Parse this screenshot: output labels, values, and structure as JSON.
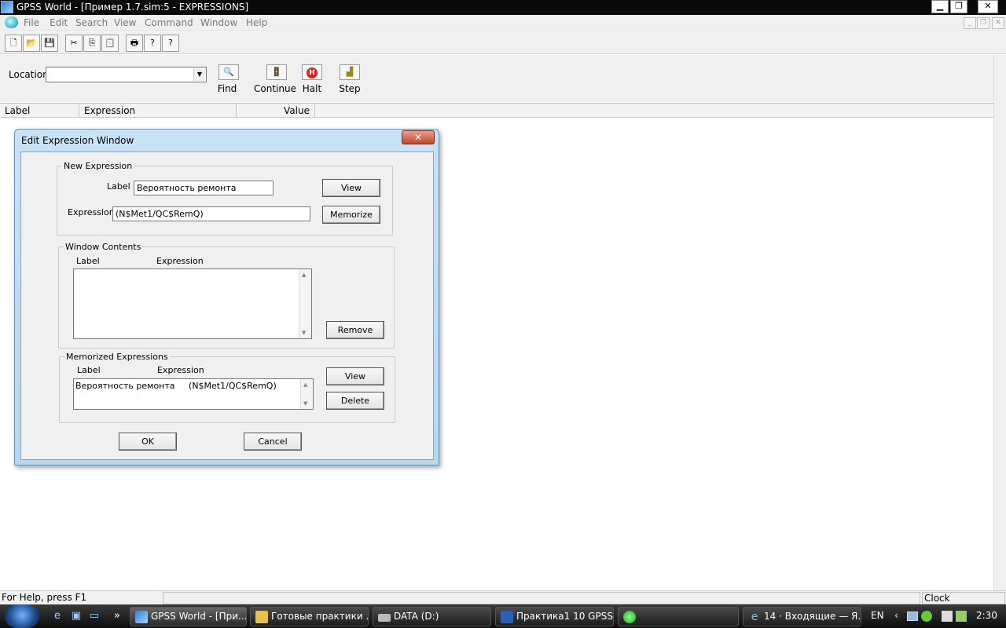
{
  "window": {
    "title": "GPSS World - [Пример 1.7.sim:5  -  EXPRESSIONS]",
    "minimize": "▁",
    "restore": "❐",
    "close": "✕"
  },
  "menu": {
    "items": [
      "File",
      "Edit",
      "Search",
      "View",
      "Command",
      "Window",
      "Help"
    ],
    "mdi_minimize": "_",
    "mdi_restore": "❐",
    "mdi_close": "✕"
  },
  "toolbar": {
    "icons": [
      "new-icon",
      "open-icon",
      "save-icon",
      "cut-icon",
      "copy-icon",
      "paste-icon",
      "print-icon",
      "help-icon",
      "context-help-icon"
    ],
    "glyphs": [
      "🗋",
      "📂",
      "💾",
      "✂",
      "⎘",
      "📋",
      "🖶",
      "?",
      "?"
    ]
  },
  "location": {
    "label": "Location",
    "value": "",
    "dropdown": "▼"
  },
  "commands": {
    "find": {
      "label": "Find",
      "glyph": "🔍"
    },
    "continue": {
      "label": "Continue",
      "glyph": "🚦"
    },
    "halt": {
      "label": "Halt",
      "glyph": "H"
    },
    "step": {
      "label": "Step",
      "glyph": "▟"
    }
  },
  "columns": {
    "label": "Label",
    "expression": "Expression",
    "value": "Value"
  },
  "dialog": {
    "title": "Edit Expression Window",
    "close": "✕",
    "new_expression": {
      "title": "New Expression",
      "label_caption": "Label",
      "label_value": "Вероятность ремонта",
      "expression_caption": "Expression",
      "expression_value": "(N$Met1/QC$RemQ)",
      "view_button": "View",
      "memorize_button": "Memorize"
    },
    "window_contents": {
      "title": "Window Contents",
      "col_label": "Label",
      "col_expression": "Expression",
      "remove_button": "Remove"
    },
    "memorized": {
      "title": "Memorized Expressions",
      "col_label": "Label",
      "col_expression": "Expression",
      "row_label": "Вероятность ремонта",
      "row_expression": "(N$Met1/QC$RemQ)",
      "view_button": "View",
      "delete_button": "Delete"
    },
    "ok_button": "OK",
    "cancel_button": "Cancel"
  },
  "status": {
    "help": "For Help, press F1",
    "clock": "Clock"
  },
  "taskbar": {
    "tasks": [
      "GPSS World - [При...",
      "Готовые практики ...",
      "DATA (D:)",
      "Практика1 10 GPSS....",
      "",
      "14 · Входящие — Я..."
    ],
    "more": "»",
    "language": "EN",
    "tray_arrow": "‹",
    "time": "2:30"
  },
  "colors": {
    "titlebar": "#0a0a0a",
    "dialog_frame": "#b7d8ef",
    "close_red": "#c2432a",
    "taskbar": "#1e1e1e"
  }
}
